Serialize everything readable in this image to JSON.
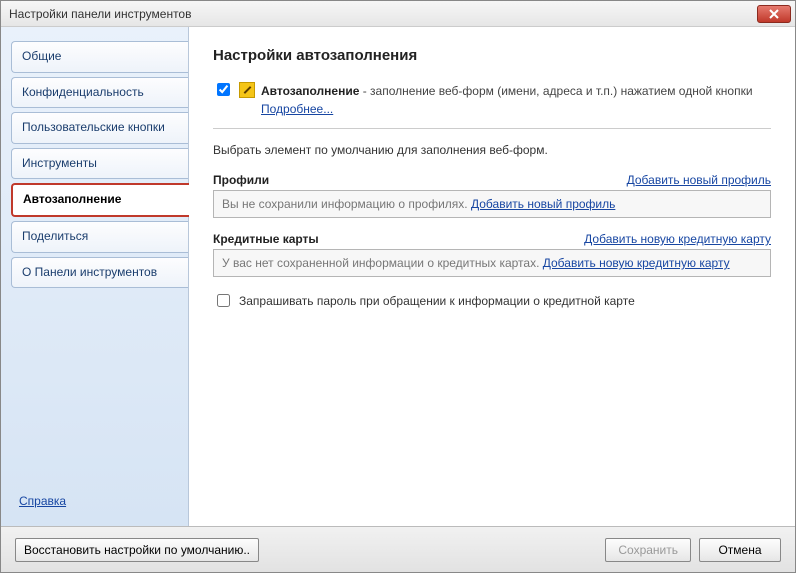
{
  "window": {
    "title": "Настройки панели инструментов"
  },
  "sidebar": {
    "items": [
      {
        "label": "Общие"
      },
      {
        "label": "Конфиденциальность"
      },
      {
        "label": "Пользовательские кнопки"
      },
      {
        "label": "Инструменты"
      },
      {
        "label": "Автозаполнение"
      },
      {
        "label": "Поделиться"
      },
      {
        "label": "О Панели инструментов"
      }
    ],
    "help": "Справка"
  },
  "content": {
    "heading": "Настройки автозаполнения",
    "autofill": {
      "checked": true,
      "name": "Автозаполнение",
      "desc": " - заполнение веб-форм (имени, адреса и т.п.) нажатием одной кнопки  ",
      "more": "Подробнее..."
    },
    "select_text": "Выбрать элемент по умолчанию для заполнения веб-форм.",
    "profiles": {
      "title": "Профили",
      "add_link": "Добавить новый профиль",
      "empty": "Вы не сохранили информацию о профилях. ",
      "empty_link": "Добавить новый профиль"
    },
    "cards": {
      "title": "Кредитные карты",
      "add_link": "Добавить новую кредитную карту",
      "empty": "У вас нет сохраненной информации о кредитных картах. ",
      "empty_link": "Добавить новую кредитную карту"
    },
    "password_prompt": {
      "checked": false,
      "label": "Запрашивать пароль при обращении к информации о кредитной карте"
    }
  },
  "footer": {
    "restore": "Восстановить настройки по умолчанию..",
    "save": "Сохранить",
    "cancel": "Отмена"
  }
}
